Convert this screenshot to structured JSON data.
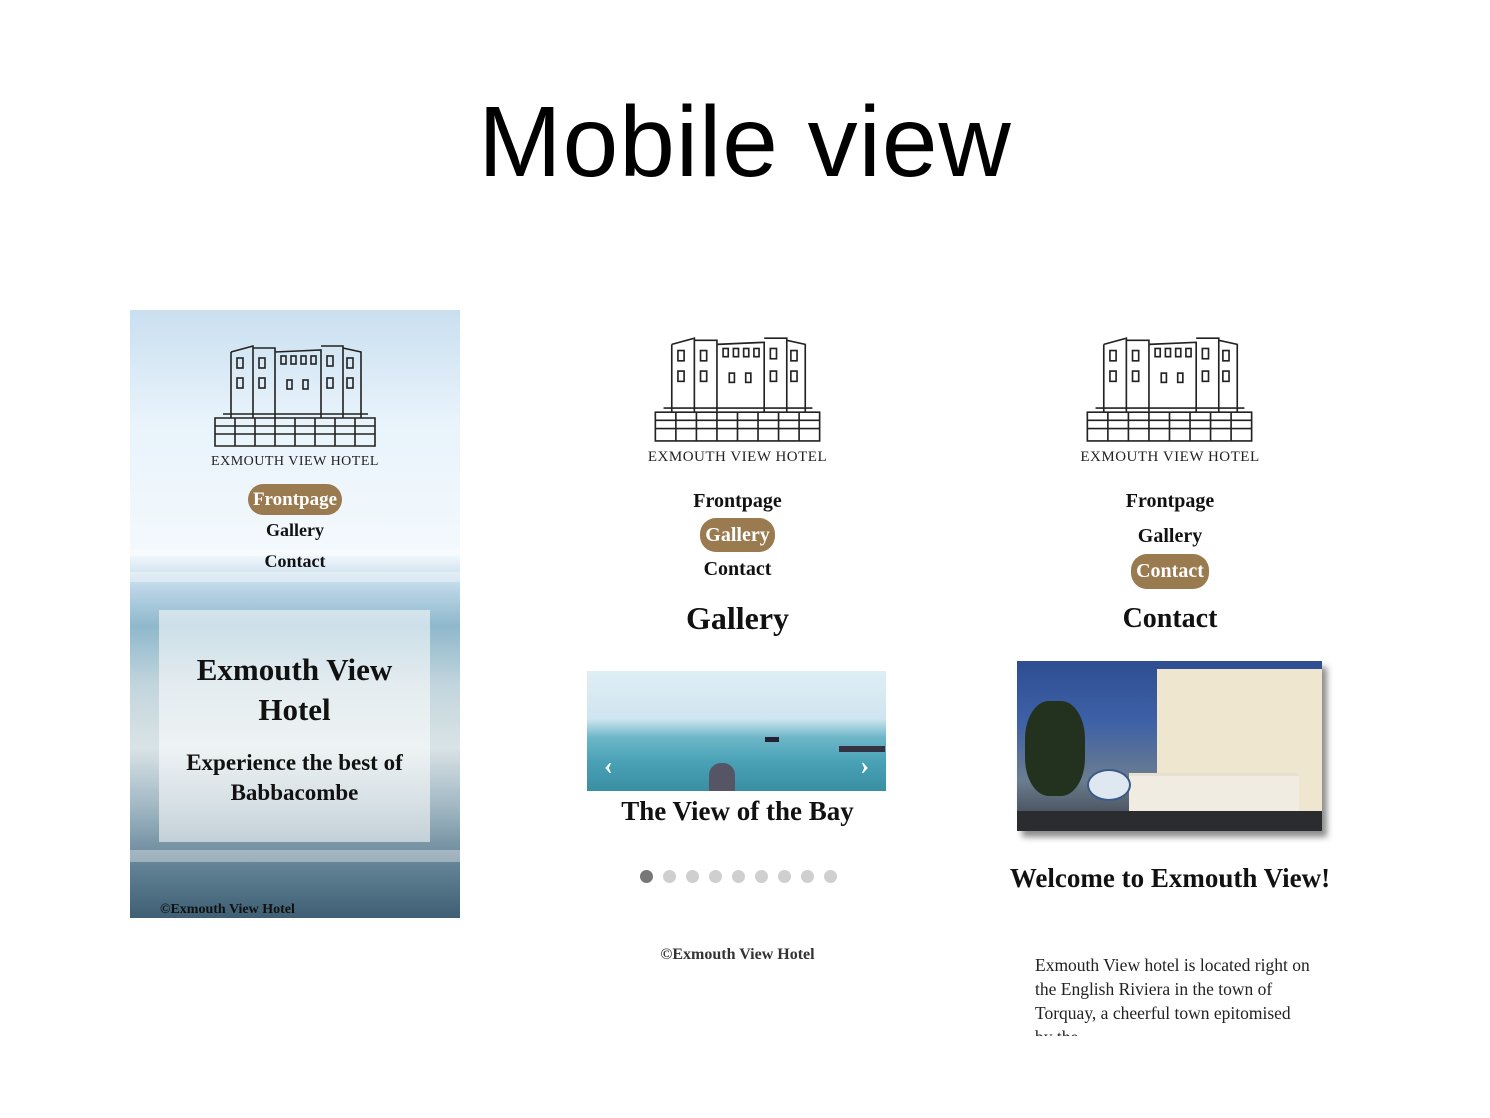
{
  "slide": {
    "title": "Mobile view"
  },
  "brand": {
    "name": "EXMOUTH VIEW HOTEL",
    "copyright": "©Exmouth View Hotel",
    "accent": "#9a7a4f"
  },
  "nav": {
    "items": [
      "Frontpage",
      "Gallery",
      "Contact"
    ]
  },
  "frontpage": {
    "active_nav": "Frontpage",
    "hero_title": "Exmouth View Hotel",
    "hero_subtitle": "Experience the best of Babbacombe"
  },
  "gallery": {
    "active_nav": "Gallery",
    "heading": "Gallery",
    "slide_caption": "The View of the Bay",
    "prev_arrow": "‹",
    "next_arrow": "›",
    "dot_count": 9,
    "active_dot": 1
  },
  "contact": {
    "active_nav": "Contact",
    "heading": "Contact",
    "welcome": "Welcome to Exmouth View!",
    "body": "Exmouth View hotel is located right on the English Riviera in the town of Torquay, a cheerful town epitomised by the"
  }
}
